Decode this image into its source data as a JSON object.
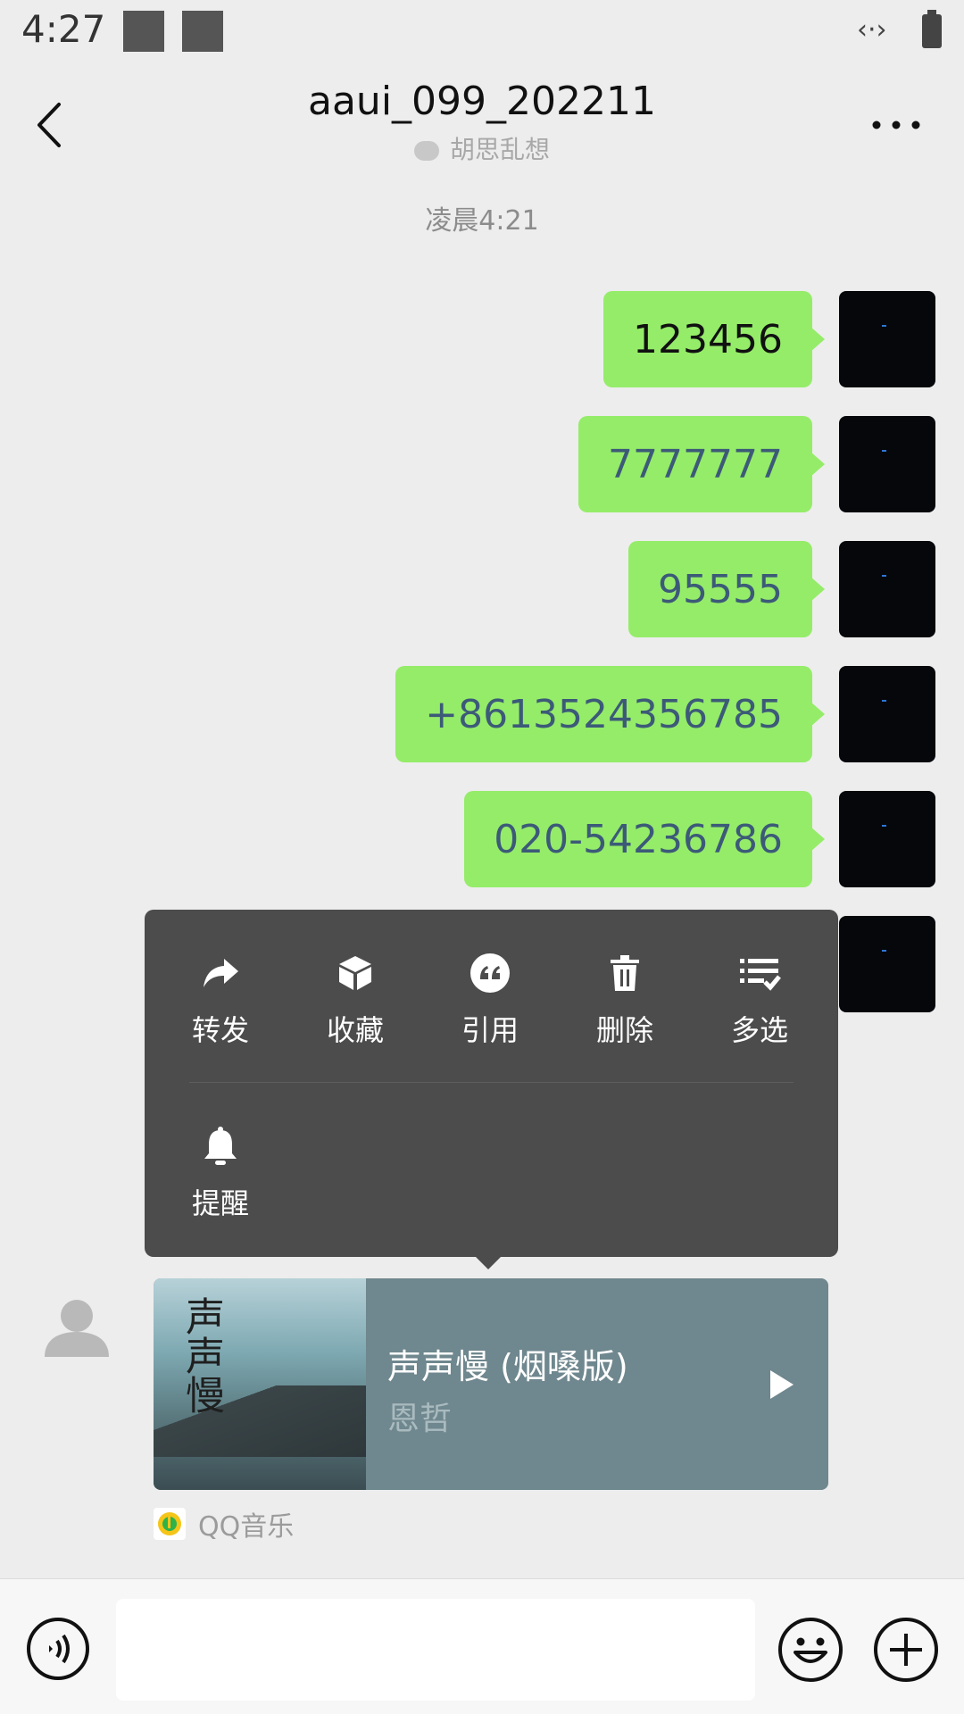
{
  "status_bar": {
    "time": "4:27",
    "net_icon": "data-transfer-icon",
    "battery_icon": "battery-icon"
  },
  "header": {
    "title": "aaui_099_202211",
    "subtitle": "胡思乱想"
  },
  "timestamp": "凌晨4:21",
  "messages": [
    {
      "text": "123456",
      "style": "plain"
    },
    {
      "text": "7777777",
      "style": "link"
    },
    {
      "text": "95555",
      "style": "link"
    },
    {
      "text": "+8613524356785",
      "style": "link"
    },
    {
      "text": "020-54236786",
      "style": "link"
    }
  ],
  "context_menu": {
    "items": [
      {
        "label": "转发",
        "icon": "forward-icon"
      },
      {
        "label": "收藏",
        "icon": "cube-icon"
      },
      {
        "label": "引用",
        "icon": "quote-icon"
      },
      {
        "label": "删除",
        "icon": "trash-icon"
      },
      {
        "label": "多选",
        "icon": "multiselect-icon"
      },
      {
        "label": "提醒",
        "icon": "bell-icon"
      }
    ]
  },
  "music_card": {
    "cover_text": "声声慢",
    "title": "声声慢 (烟嗓版)",
    "artist": "恩哲",
    "source": "QQ音乐"
  },
  "colors": {
    "sent_bubble": "#95ec69",
    "link_text": "#3c5a78",
    "menu_bg": "#4c4c4c",
    "card_bg": "#6f878e"
  }
}
